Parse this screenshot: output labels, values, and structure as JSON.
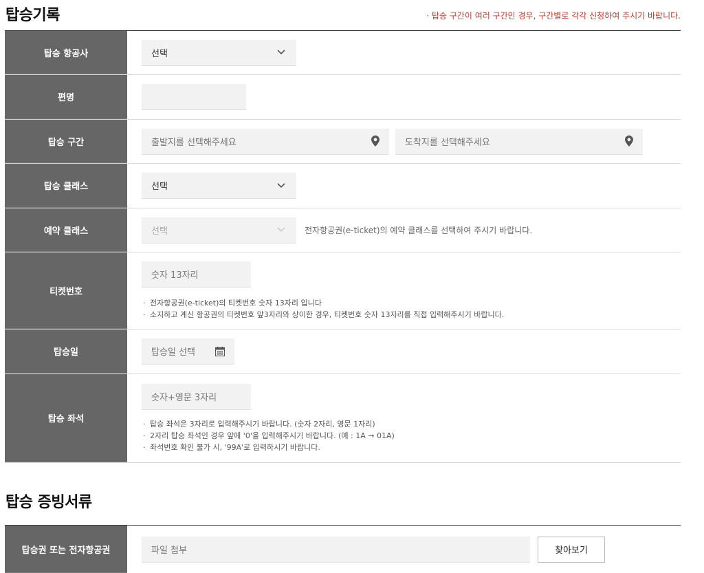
{
  "boarding_record": {
    "title": "탑승기록",
    "notice": "· 탑승 구간이 여러 구간인 경우, 구간별로 각각 신청하여 주시기 바랍니다.",
    "airline": {
      "label": "탑승 항공사",
      "value": "선택"
    },
    "flight_no": {
      "label": "편명",
      "value": ""
    },
    "route": {
      "label": "탑승 구간",
      "departure_placeholder": "출발지를 선택해주세요",
      "arrival_placeholder": "도착지를 선택해주세요"
    },
    "cabin_class": {
      "label": "탑승 클래스",
      "value": "선택"
    },
    "booking_class": {
      "label": "예약 클래스",
      "value": "선택",
      "help": "전자항공권(e-ticket)의 예약 클래스를 선택하여 주시기 바랍니다."
    },
    "ticket_no": {
      "label": "티켓번호",
      "placeholder": "숫자 13자리",
      "notes": [
        "전자항공권(e-ticket)의 티켓번호 숫자 13자리 입니다",
        "소지하고 계신 항공권의 티켓번호 앞3자리와 상이한 경우, 티켓번호 숫자 13자리를 직접 입력해주시기 바랍니다."
      ]
    },
    "boarding_date": {
      "label": "탑승일",
      "placeholder": "탑승일 선택"
    },
    "seat": {
      "label": "탑승 좌석",
      "placeholder": "숫자+영문 3자리",
      "notes": [
        "탑승 좌석은 3자리로 입력해주시기 바랍니다. (숫자 2자리, 영문 1자리)",
        "2자리 탑승 좌석인 경우 앞에 '0'을 입력해주시기 바랍니다. (예 : 1A → 01A)",
        "좌석번호 확인 불가 시, '99A'로 입력하시기 바랍니다."
      ]
    }
  },
  "proof_docs": {
    "title": "탑승 증빙서류",
    "file": {
      "label": "탑승권 또는 전자항공권",
      "placeholder": "파일 첨부",
      "browse_label": "찾아보기"
    }
  },
  "icons": {
    "select_arrow": "chevron-down-icon",
    "location": "map-pin-icon",
    "date": "calendar-icon"
  }
}
